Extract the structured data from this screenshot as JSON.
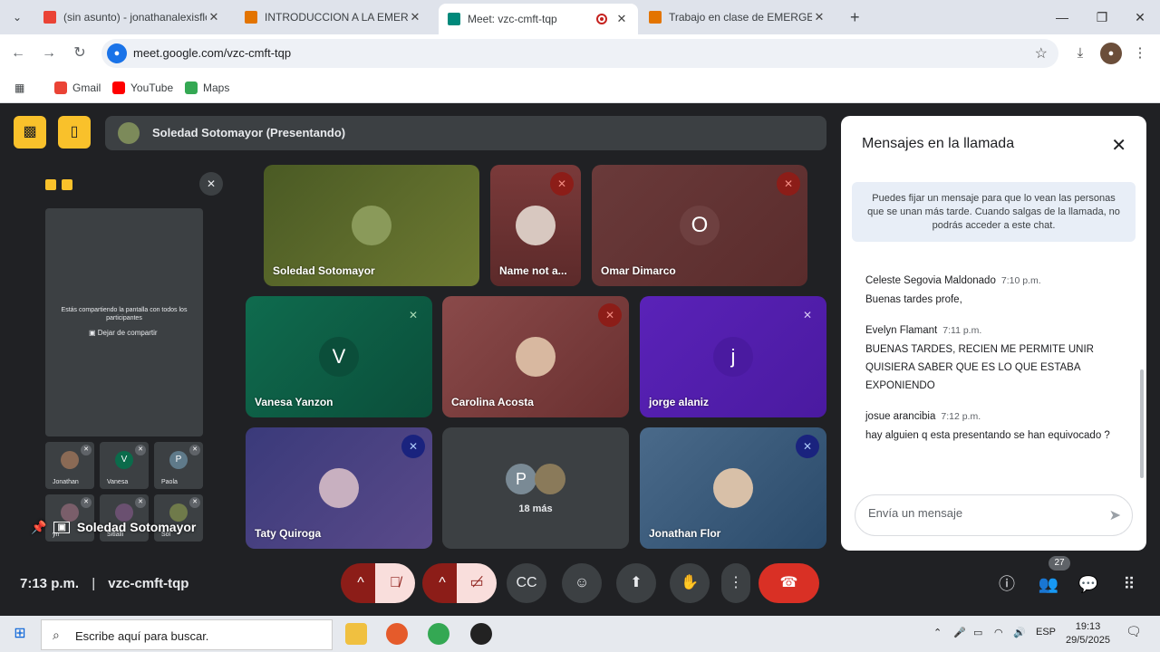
{
  "browser": {
    "tabs": [
      {
        "title": "(sin asunto) - jonathanalexisflor",
        "active": false
      },
      {
        "title": "INTRODUCCION A LA EMERGEN",
        "active": false
      },
      {
        "title": "Meet: vzc-cmft-tqp",
        "active": true
      },
      {
        "title": "Trabajo en clase de EMERGENT",
        "active": false
      }
    ],
    "new_tab": "+",
    "url": "meet.google.com/vzc-cmft-tqp",
    "bookmarks": [
      "Gmail",
      "YouTube",
      "Maps"
    ]
  },
  "meet": {
    "presenter_bar": "Soledad Sotomayor (Presentando)",
    "share_notice": "Estás compartiendo la pantalla con todos los participantes",
    "stop_sharing": "Dejar de compartir",
    "pinned_label": "Soledad Sotomayor",
    "thumbnails": [
      {
        "name": "Jonathan",
        "initial": ""
      },
      {
        "name": "Vanesa",
        "initial": "V"
      },
      {
        "name": "Paola",
        "initial": "P"
      },
      {
        "name": "yn",
        "initial": ""
      },
      {
        "name": "Sitlalli",
        "initial": ""
      },
      {
        "name": "Sol",
        "initial": ""
      }
    ],
    "tiles": {
      "soledad": {
        "name": "Soledad Sotomayor"
      },
      "name_not": {
        "name": "Name not a..."
      },
      "omar": {
        "name": "Omar Dimarco",
        "initial": "O"
      },
      "vanesa": {
        "name": "Vanesa Yanzon",
        "initial": "V"
      },
      "carolina": {
        "name": "Carolina Acosta"
      },
      "jorge": {
        "name": "jorge alaniz",
        "initial": "j"
      },
      "taty": {
        "name": "Taty Quiroga"
      },
      "more": {
        "label": "18 más",
        "initial": "P"
      },
      "jonathan": {
        "name": "Jonathan Flor"
      }
    },
    "meeting_time": "7:13 p.m.",
    "meeting_code": "vzc-cmft-tqp",
    "participants_count": "27"
  },
  "chat": {
    "title": "Mensajes en la llamada",
    "notice": "Puedes fijar un mensaje para que lo vean las personas que se unan más tarde. Cuando salgas de la llamada, no podrás acceder a este chat.",
    "messages": [
      {
        "sender": "Celeste Segovia Maldonado",
        "time": "7:10 p.m.",
        "body": "Buenas tardes profe,"
      },
      {
        "sender": "Evelyn Flamant",
        "time": "7:11 p.m.",
        "body": "BUENAS TARDES, RECIEN ME PERMITE UNIR QUISIERA SABER QUE ES LO QUE ESTABA EXPONIENDO"
      },
      {
        "sender": "josue arancibia",
        "time": "7:12 p.m.",
        "body": "hay alguien q esta presentando se han equivocado ?"
      }
    ],
    "input_placeholder": "Envía un mensaje"
  },
  "taskbar": {
    "search_placeholder": "Escribe aquí para buscar.",
    "language": "ESP",
    "time": "19:13",
    "date": "29/5/2025"
  }
}
